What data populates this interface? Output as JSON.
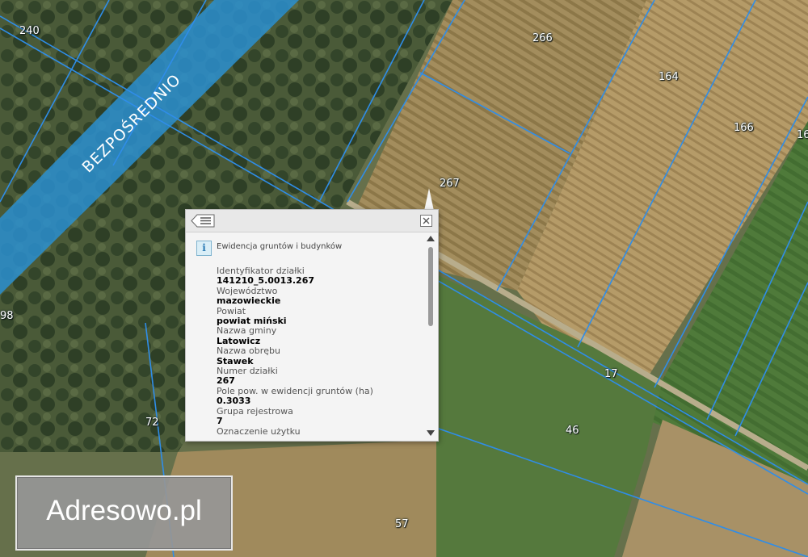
{
  "map": {
    "plot_numbers": [
      "240",
      "266",
      "164",
      "166",
      "16",
      "267",
      "98",
      "17",
      "72",
      "46",
      "57"
    ],
    "road_label": "BEZPOŚREDNIO",
    "colors": {
      "parcel_border": "#2f8de8",
      "road_band": "#2a8fd0",
      "plot_label_text": "#ffffff"
    }
  },
  "popup": {
    "back_icon": "list-back-icon",
    "close_icon": "close-x-icon",
    "info_icon": "info-icon",
    "info_icon_glyph": "i",
    "layer_title": "Ewidencja gruntów i budynków",
    "attributes": [
      {
        "label": "Identyfikator działki",
        "value": "141210_5.0013.267"
      },
      {
        "label": "Województwo",
        "value": "mazowieckie"
      },
      {
        "label": "Powiat",
        "value": "powiat miński"
      },
      {
        "label": "Nazwa gminy",
        "value": "Latowicz"
      },
      {
        "label": "Nazwa obrębu",
        "value": "Stawek"
      },
      {
        "label": "Numer działki",
        "value": "267"
      },
      {
        "label": "Pole pow. w ewidencji gruntów (ha)",
        "value": "0.3033"
      },
      {
        "label": "Grupa rejestrowa",
        "value": "7"
      },
      {
        "label": "Oznaczenie użytku",
        "value": ""
      }
    ]
  },
  "watermark": {
    "text": "Adresowo.pl"
  }
}
